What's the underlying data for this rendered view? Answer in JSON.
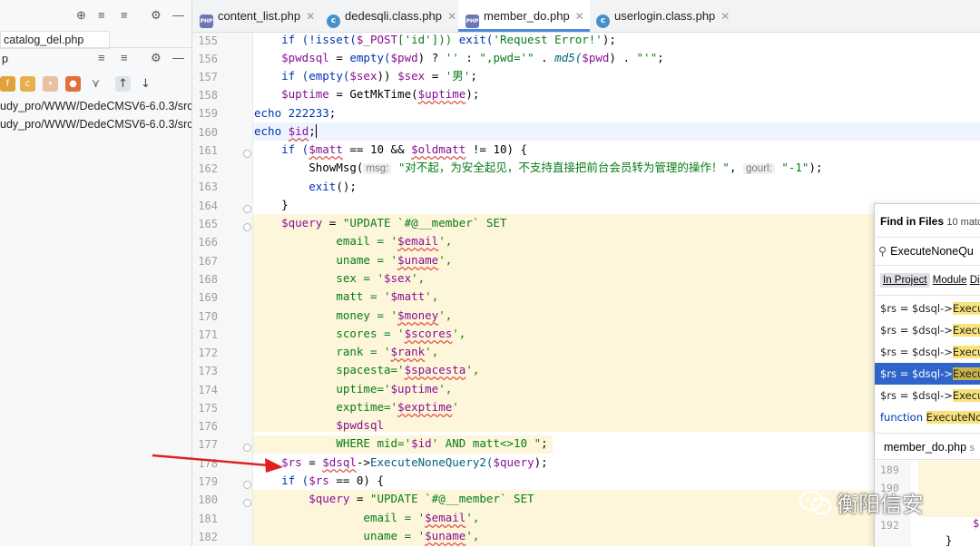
{
  "left_panel": {
    "file1": "catalog_del.php",
    "section2": "p",
    "path1": "udy_pro/WWW/DedeCMSV6-6.0.3/src",
    "path2": "udy_pro/WWW/DedeCMSV6-6.0.3/src"
  },
  "tabs": [
    {
      "label": "content_list.php",
      "icon": "php-file-icon",
      "active": false
    },
    {
      "label": "dedesqli.class.php",
      "icon": "class-file-icon",
      "active": false
    },
    {
      "label": "member_do.php",
      "icon": "php-file-icon",
      "active": true
    },
    {
      "label": "userlogin.class.php",
      "icon": "class-file-icon",
      "active": false
    }
  ],
  "line_numbers": [
    "155",
    "156",
    "157",
    "158",
    "159",
    "160",
    "161",
    "162",
    "163",
    "164",
    "165",
    "166",
    "167",
    "168",
    "169",
    "170",
    "171",
    "172",
    "173",
    "174",
    "175",
    "176",
    "177",
    "178",
    "179",
    "180",
    "181",
    "182"
  ],
  "code": {
    "l155_a": "    if (!isset(",
    "l155_b": "$_POST",
    "l155_c": "['id'])) ",
    "l155_d": "exit(",
    "l155_e": "'Request Error!'",
    "l155_f": ");",
    "l156_a": "$pwdsql",
    "l156_b": " = ",
    "l156_c": "empty(",
    "l156_d": "$pwd",
    "l156_e": ") ? ",
    "l156_f": "''",
    "l156_g": " : ",
    "l156_h": "\",pwd='\"",
    "l156_i": " . ",
    "l156_j": "md5(",
    "l156_k": "$pwd",
    "l156_l": ") . ",
    "l156_m": "\"'\"",
    "l156_n": ";",
    "l157_a": "    if (",
    "l157_b": "empty(",
    "l157_c": "$sex",
    "l157_d": ")) ",
    "l157_e": "$sex",
    "l157_f": " = ",
    "l157_g": "'男'",
    "l157_h": ";",
    "l158_a": "$uptime",
    "l158_b": " = GetMkTime(",
    "l158_c": "$uptime",
    "l158_d": ");",
    "l159_a": "echo ",
    "l159_b": "222233",
    "l159_c": ";",
    "l160_a": "echo ",
    "l160_b": "$id",
    "l160_c": ";",
    "l161_a": "    if (",
    "l161_b": "$matt",
    "l161_c": " == 10 && ",
    "l161_d": "$oldmatt",
    "l161_e": " != 10) {",
    "l162_a": "ShowMsg(",
    "l162_hint1": "msg:",
    "l162_b": "\"对不起，为安全起见，不支持直接把前台会员转为管理的操作！\"",
    "l162_c": ", ",
    "l162_hint2": "gourl:",
    "l162_d": "\"-1\"",
    "l162_e": ");",
    "l163_a": "exit",
    "l163_b": "();",
    "l164": "    }",
    "l165_a": "$query",
    "l165_b": " = ",
    "l165_c": "\"UPDATE `#@__member` SET",
    "l166_a": "email = '",
    "l166_b": "$email",
    "l166_c": "',",
    "l167_a": "uname = '",
    "l167_b": "$uname",
    "l167_c": "',",
    "l168_a": "sex = '",
    "l168_b": "$sex",
    "l168_c": "',",
    "l169_a": "matt = '",
    "l169_b": "$matt",
    "l169_c": "',",
    "l170_a": "money = '",
    "l170_b": "$money",
    "l170_c": "',",
    "l171_a": "scores = '",
    "l171_b": "$scores",
    "l171_c": "',",
    "l172_a": "rank = '",
    "l172_b": "$rank",
    "l172_c": "',",
    "l173_a": "spacesta='",
    "l173_b": "$spacesta",
    "l173_c": "',",
    "l174_a": "uptime='",
    "l174_b": "$uptime",
    "l174_c": "',",
    "l175_a": "exptime='",
    "l175_b": "$exptime",
    "l175_c": "'",
    "l176": "$pwdsql",
    "l177_a": "WHERE mid='",
    "l177_b": "$id",
    "l177_c": "' AND matt<>10 \"",
    "l177_d": ";",
    "l178_a": "$rs",
    "l178_b": " = ",
    "l178_c": "$dsql",
    "l178_d": "->",
    "l178_e": "ExecuteNoneQuery2(",
    "l178_f": "$query",
    "l178_g": ");",
    "l179_a": "    if (",
    "l179_b": "$rs",
    "l179_c": " == 0) {",
    "l180_a": "$query",
    "l180_b": " = ",
    "l180_c": "\"UPDATE `#@__member` SET",
    "l181_a": "email = '",
    "l181_b": "$email",
    "l181_c": "',",
    "l182_a": "uname = '",
    "l182_b": "$uname",
    "l182_c": "',"
  },
  "find_panel": {
    "title": "Find in Files",
    "count": "10 matc",
    "query": "ExecuteNoneQu",
    "scope_project": "In Project",
    "scope_module": "Module",
    "scope_dir": "Di",
    "results": [
      {
        "prefix": "$rs = $dsql->",
        "match": "Execut"
      },
      {
        "prefix": "$rs = $dsql->",
        "match": "Execut"
      },
      {
        "prefix": "$rs = $dsql->",
        "match": "Execut"
      },
      {
        "prefix": "$rs = $dsql->",
        "match": "Execut"
      },
      {
        "prefix": "$rs = $dsql->",
        "match": "Execut"
      },
      {
        "prefix": "function ",
        "match": "ExecuteNo"
      }
    ],
    "preview_file": "member_do.php",
    "preview_more": "s",
    "preview_lines": [
      "189",
      "190",
      "192"
    ],
    "preview_code_192": "$"
  },
  "watermark": "衡阳信安"
}
